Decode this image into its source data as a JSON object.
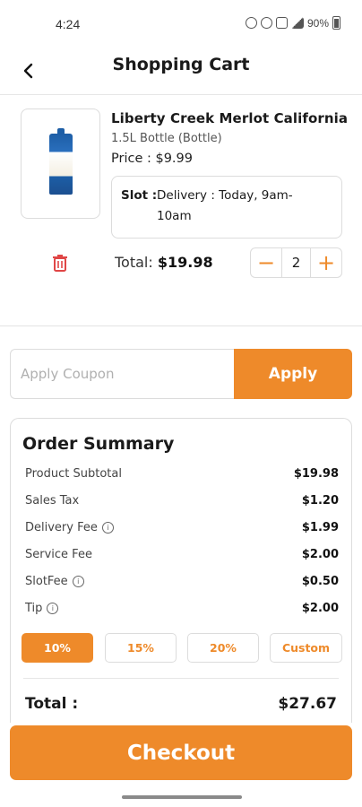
{
  "status_bar": {
    "time": "4:24",
    "battery": "90%"
  },
  "header": {
    "title": "Shopping Cart",
    "back_icon": "chevron-left-icon"
  },
  "item": {
    "name": "Liberty Creek Merlot California",
    "size": "1.5L Bottle (Bottle)",
    "price": "Price : $9.99",
    "slot_label": "Slot :",
    "slot_value": "Delivery : Today, 9am-10am",
    "total_label": "Total: ",
    "total_value": "$19.98",
    "quantity": "2",
    "decrement": "−",
    "increment": "+"
  },
  "coupon": {
    "placeholder": "Apply Coupon",
    "button": "Apply"
  },
  "summary": {
    "title": "Order Summary",
    "rows": [
      {
        "label": "Product Subtotal",
        "value": "$19.98"
      },
      {
        "label": "Sales Tax",
        "value": "$1.20"
      },
      {
        "label": "Delivery Fee",
        "value": "$1.99"
      },
      {
        "label": "Service Fee",
        "value": "$2.00"
      },
      {
        "label": "SlotFee",
        "value": "$0.50"
      },
      {
        "label": "Tip",
        "value": "$2.00"
      }
    ],
    "info_glyph": "i",
    "tips": [
      "10%",
      "15%",
      "20%",
      "Custom"
    ],
    "selected_tip": "10%",
    "total_label": "Total :",
    "total_value": "$27.67"
  },
  "checkout": {
    "label": "Checkout"
  },
  "colors": {
    "accent": "#ee8a2a",
    "delete": "#e04646"
  }
}
